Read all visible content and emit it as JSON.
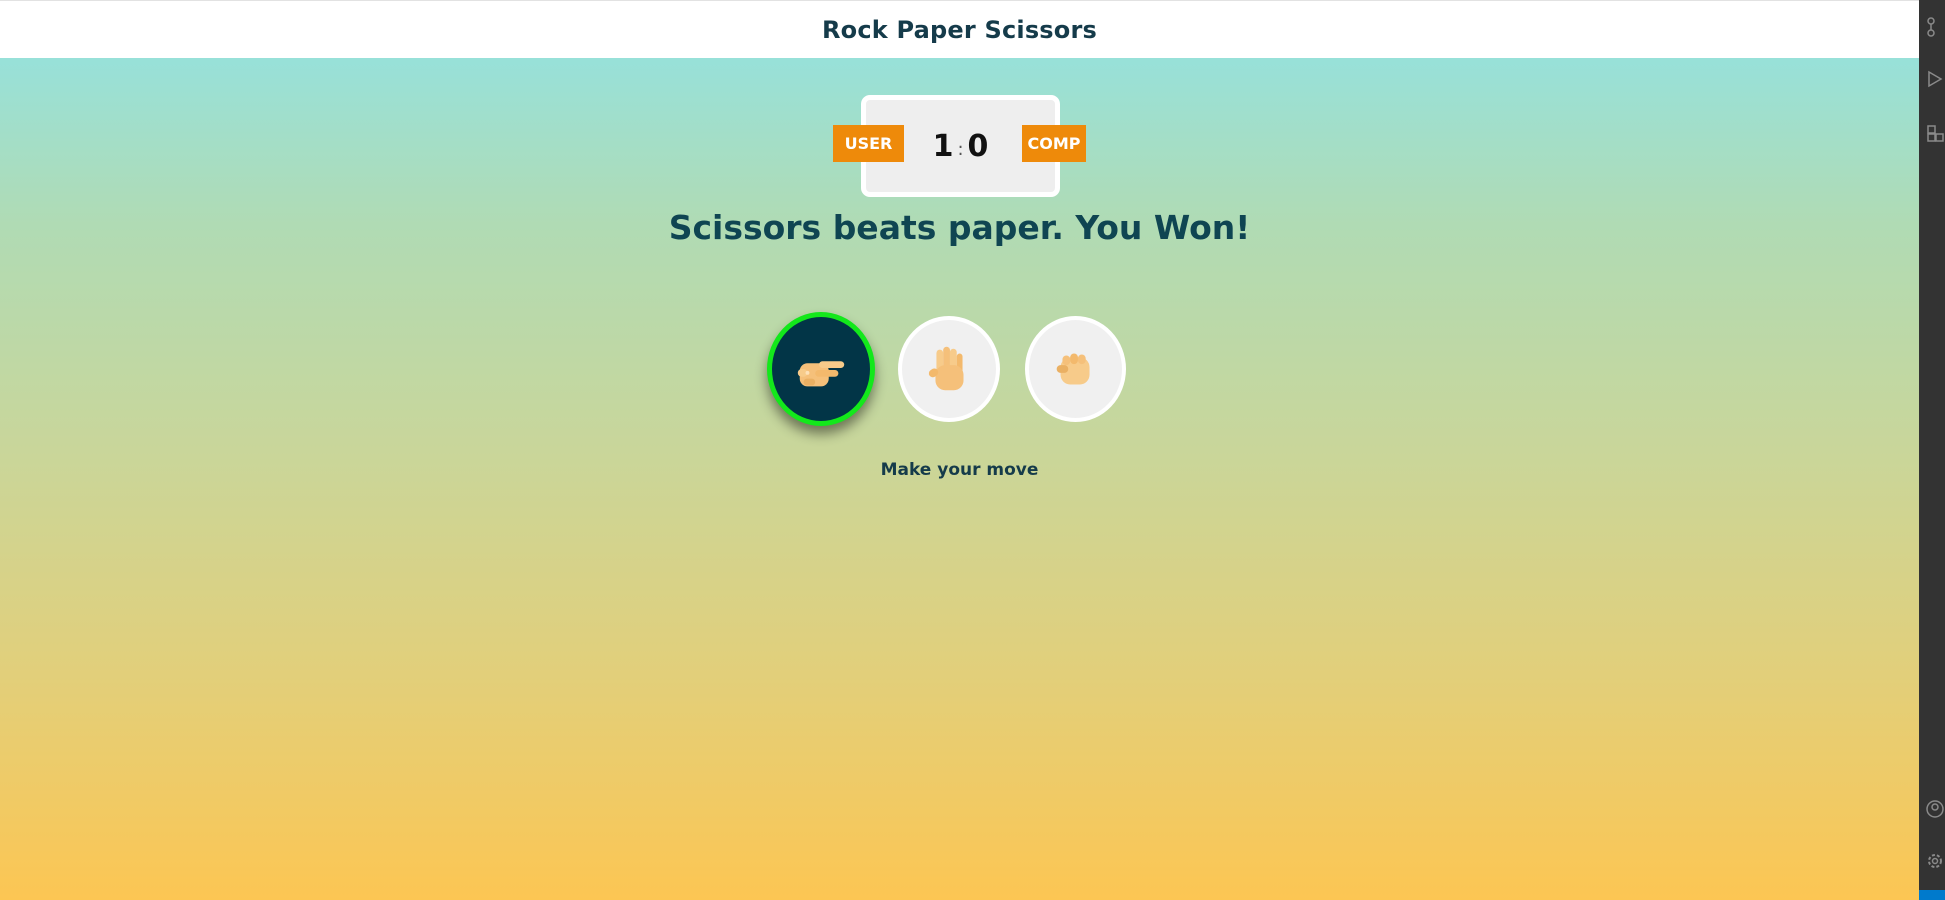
{
  "header": {
    "title": "Rock Paper Scissors"
  },
  "scoreboard": {
    "user_label": "USER",
    "comp_label": "COMP",
    "user_score": "1",
    "separator": ":",
    "comp_score": "0"
  },
  "result_message": "Scissors beats paper. You Won!",
  "choices": [
    {
      "name": "scissors",
      "icon": "scissors-hand-icon",
      "selected": true
    },
    {
      "name": "paper",
      "icon": "paper-hand-icon",
      "selected": false
    },
    {
      "name": "rock",
      "icon": "rock-hand-icon",
      "selected": false
    }
  ],
  "hint": "Make your move",
  "colors": {
    "badge": "#ee8a0a",
    "title_text": "#153b4a",
    "selected_ring": "#13e81b",
    "selected_fill": "#023547",
    "gradient_top": "#8fe3e6",
    "gradient_bottom": "#fcc653"
  },
  "sidebar_icons": [
    "source-control-icon",
    "run-debug-icon",
    "extensions-icon",
    "account-icon",
    "settings-gear-icon"
  ]
}
